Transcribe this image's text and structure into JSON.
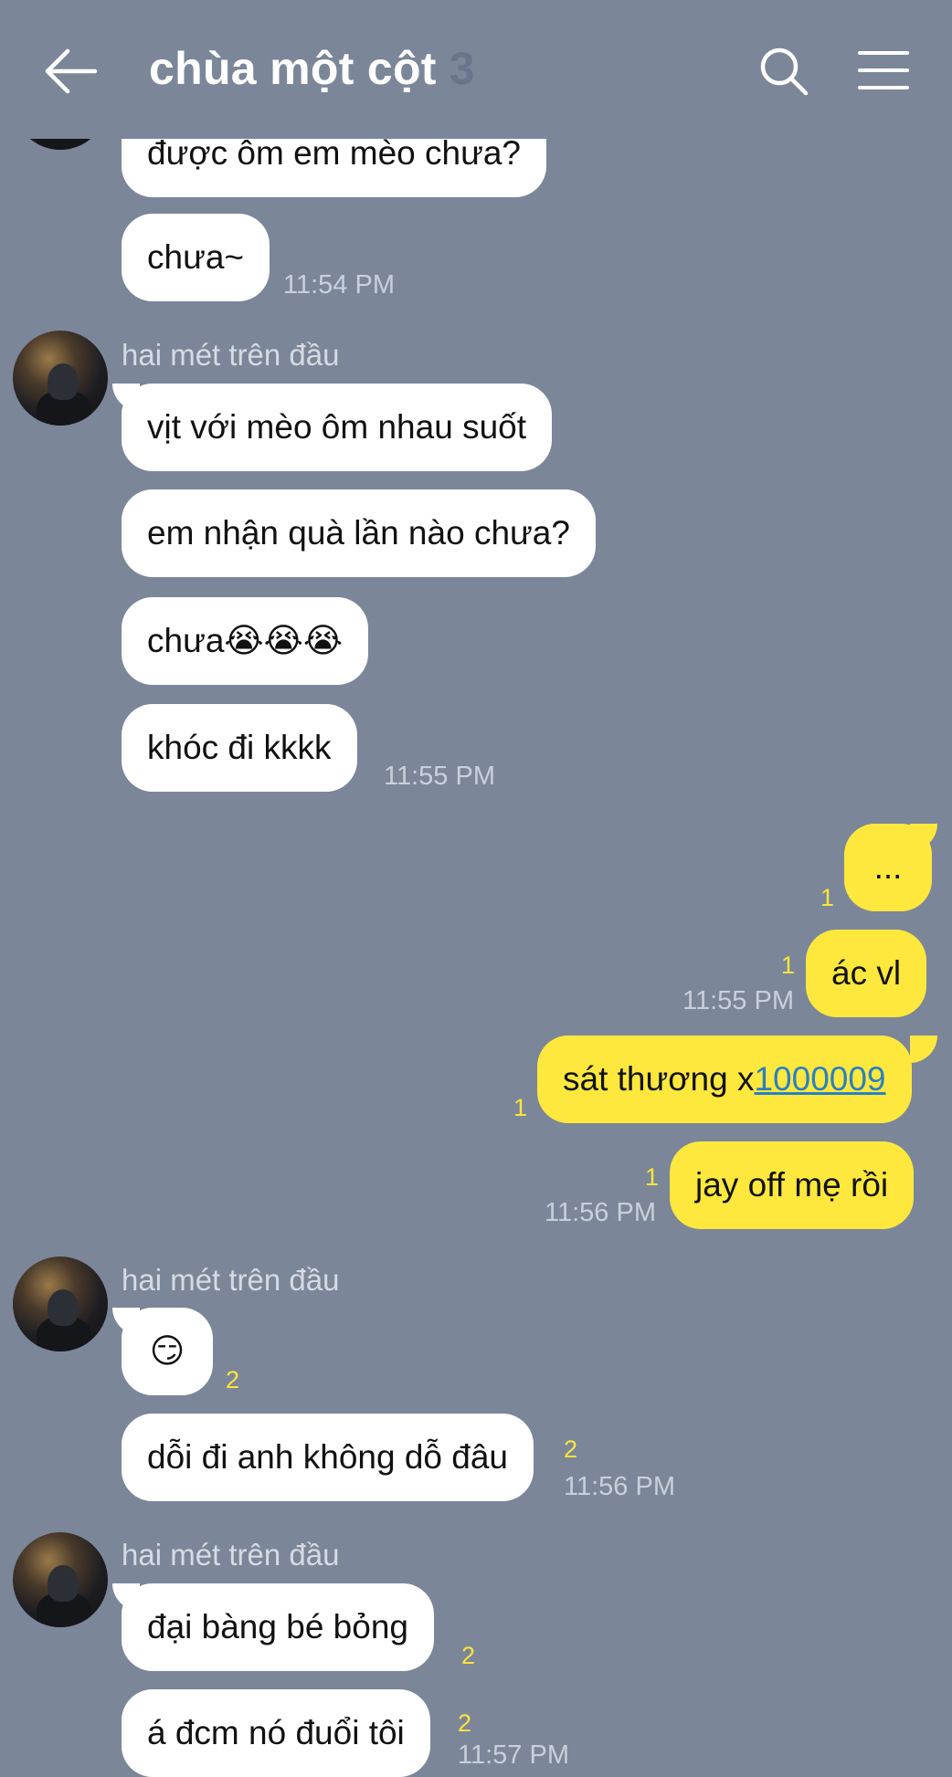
{
  "header": {
    "title": "chùa một cột",
    "member_count": "3"
  },
  "sender_name": "hai mét trên đầu",
  "messages": {
    "m0": "được ôm em mèo chưa?",
    "m1": "chưa~",
    "m2": "vịt với mèo ôm nhau suốt",
    "m3": "em nhận quà lần nào chưa?",
    "m4": "chưa😭😭😭",
    "m5": "khóc đi kkkk",
    "m6": "...",
    "m7": "ác vl",
    "m8_prefix": "sát thương x",
    "m8_link": "1000009",
    "m9": "jay off mẹ rồi",
    "m10": "😏",
    "m11": "dỗi đi anh không dỗ đâu",
    "m12": "đại bàng bé bỏng",
    "m13": "á đcm nó đuổi tôi"
  },
  "times": {
    "t1": "11:54 PM",
    "t2": "11:55 PM",
    "t3": "11:55 PM",
    "t4": "11:56 PM",
    "t5": "11:56 PM",
    "t6": "11:57 PM"
  },
  "unread": {
    "u1": "1",
    "u2": "1",
    "u3": "1",
    "u4": "1",
    "u5": "2",
    "u6": "2",
    "u7": "2",
    "u8": "2"
  },
  "colors": {
    "background": "#7b8699",
    "incoming_bubble": "#ffffff",
    "outgoing_bubble": "#fee83d",
    "unread_count": "#ffe43a",
    "link": "#2b7fc4"
  }
}
